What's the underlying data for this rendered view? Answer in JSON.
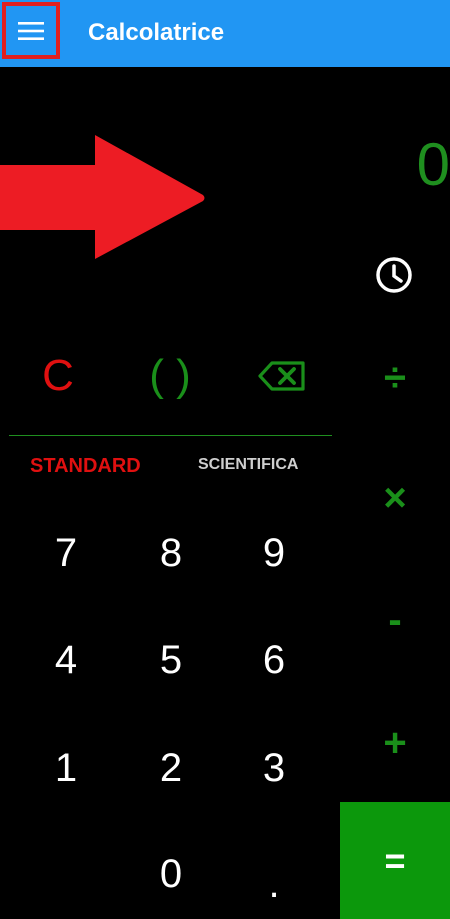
{
  "app_bar": {
    "title": "Calcolatrice",
    "menu_icon": "hamburger-menu-icon",
    "color": "#2196f3"
  },
  "annotation": {
    "arrow_icon": "red-arrow-right",
    "highlight_color": "#e02020"
  },
  "display": {
    "value": "0",
    "color": "#1f8f1f"
  },
  "history_icon": "clock-icon",
  "controls": {
    "clear": "C",
    "parentheses": "( )",
    "backspace_icon": "backspace-icon"
  },
  "tabs": {
    "standard": "STANDARD",
    "scientific": "SCIENTIFICA",
    "active": "STANDARD"
  },
  "keys": {
    "k7": "7",
    "k8": "8",
    "k9": "9",
    "k4": "4",
    "k5": "5",
    "k6": "6",
    "k1": "1",
    "k2": "2",
    "k3": "3",
    "k0": "0",
    "dot": "."
  },
  "operators": {
    "divide": "÷",
    "multiply": "×",
    "minus": "-",
    "plus": "+",
    "equals": "="
  },
  "colors": {
    "accent_green": "#1a8f1a",
    "equals_bg": "#0c980c",
    "clear_red": "#e01010"
  }
}
